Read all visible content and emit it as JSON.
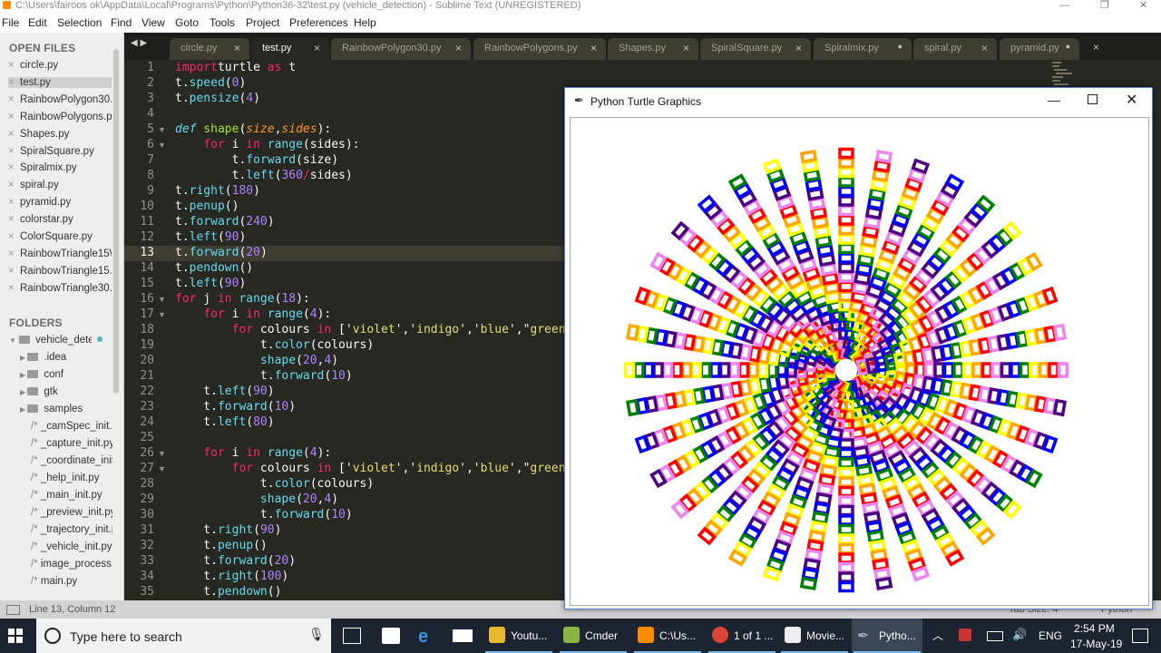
{
  "window": {
    "title": "C:\\Users\\fairoos ok\\AppData\\Local\\Programs\\Python\\Python36-32\\test.py (vehicle_detection) - Sublime Text (UNREGISTERED)"
  },
  "menu": [
    "File",
    "Edit",
    "Selection",
    "Find",
    "View",
    "Goto",
    "Tools",
    "Project",
    "Preferences",
    "Help"
  ],
  "sidebar": {
    "open_files_heading": "OPEN FILES",
    "open_files": [
      "circle.py",
      "test.py",
      "RainbowPolygon30.py",
      "RainbowPolygons.py",
      "Shapes.py",
      "SpiralSquare.py",
      "Spiralmix.py",
      "spiral.py",
      "pyramid.py",
      "colorstar.py",
      "ColorSquare.py",
      "RainbowTriangle15W",
      "RainbowTriangle15.py",
      "RainbowTriangle30.py"
    ],
    "folders_heading": "FOLDERS",
    "root_folder": "vehicle_detection",
    "folders": [
      ".idea",
      "conf",
      "gtk",
      "samples"
    ],
    "files": [
      "_camSpec_init.py",
      "_capture_init.py",
      "_coordinate_init.py",
      "_help_init.py",
      "_main_init.py",
      "_preview_init.py",
      "_trajectory_init.py",
      "_vehicle_init.py",
      "image_process.py",
      "main.py"
    ]
  },
  "tabs": [
    {
      "label": "circle.py",
      "state": "close"
    },
    {
      "label": "test.py",
      "state": "close",
      "active": true
    },
    {
      "label": "RainbowPolygon30.py",
      "state": "close"
    },
    {
      "label": "RainbowPolygons.py",
      "state": "close"
    },
    {
      "label": "Shapes.py",
      "state": "close"
    },
    {
      "label": "SpiralSquare.py",
      "state": "close"
    },
    {
      "label": "Spiralmix.py",
      "state": "dirty"
    },
    {
      "label": "spiral.py",
      "state": "close"
    },
    {
      "label": "pyramid.py",
      "state": "dirty"
    }
  ],
  "editor": {
    "current_line": 13,
    "lines": [
      [
        [
          "k",
          "import"
        ],
        [
          "",
          "turtle "
        ],
        [
          "k",
          "as"
        ],
        [
          "",
          " t"
        ]
      ],
      [
        [
          "",
          "t."
        ],
        [
          "f",
          "speed"
        ],
        [
          "",
          "("
        ],
        [
          "n",
          "0"
        ],
        [
          "",
          ")"
        ]
      ],
      [
        [
          "",
          "t."
        ],
        [
          "f",
          "pensize"
        ],
        [
          "",
          "("
        ],
        [
          "n",
          "4"
        ],
        [
          "",
          ")"
        ]
      ],
      [],
      [
        [
          "i",
          "def"
        ],
        [
          "",
          " "
        ],
        [
          "fn",
          "shape"
        ],
        [
          "",
          "("
        ],
        [
          "p",
          "size"
        ],
        [
          "",
          ","
        ],
        [
          "p",
          "sides"
        ],
        [
          "",
          "):"
        ]
      ],
      [
        [
          "",
          "    "
        ],
        [
          "k",
          "for"
        ],
        [
          "",
          " i "
        ],
        [
          "k",
          "in"
        ],
        [
          "",
          " "
        ],
        [
          "f",
          "range"
        ],
        [
          "",
          "(sides):"
        ]
      ],
      [
        [
          "",
          "        t."
        ],
        [
          "f",
          "forward"
        ],
        [
          "",
          "(size)"
        ]
      ],
      [
        [
          "",
          "        t."
        ],
        [
          "f",
          "left"
        ],
        [
          "",
          "("
        ],
        [
          "n",
          "360"
        ],
        [
          "k",
          "/"
        ],
        [
          "",
          "sides)"
        ]
      ],
      [
        [
          "",
          "t."
        ],
        [
          "f",
          "right"
        ],
        [
          "",
          "("
        ],
        [
          "n",
          "180"
        ],
        [
          "",
          ")"
        ]
      ],
      [
        [
          "",
          "t."
        ],
        [
          "f",
          "penup"
        ],
        [
          "",
          "()"
        ]
      ],
      [
        [
          "",
          "t."
        ],
        [
          "f",
          "forward"
        ],
        [
          "",
          "("
        ],
        [
          "n",
          "240"
        ],
        [
          "",
          ")"
        ]
      ],
      [
        [
          "",
          "t."
        ],
        [
          "f",
          "left"
        ],
        [
          "",
          "("
        ],
        [
          "n",
          "90"
        ],
        [
          "",
          ")"
        ]
      ],
      [
        [
          "",
          "t."
        ],
        [
          "f",
          "forward"
        ],
        [
          "",
          "("
        ],
        [
          "n",
          "20"
        ],
        [
          "",
          ")"
        ]
      ],
      [
        [
          "",
          "t."
        ],
        [
          "f",
          "pendown"
        ],
        [
          "",
          "()"
        ]
      ],
      [
        [
          "",
          "t."
        ],
        [
          "f",
          "left"
        ],
        [
          "",
          "("
        ],
        [
          "n",
          "90"
        ],
        [
          "",
          ")"
        ]
      ],
      [
        [
          "k",
          "for"
        ],
        [
          "",
          " j "
        ],
        [
          "k",
          "in"
        ],
        [
          "",
          " "
        ],
        [
          "f",
          "range"
        ],
        [
          "",
          "("
        ],
        [
          "n",
          "18"
        ],
        [
          "",
          "):"
        ]
      ],
      [
        [
          "",
          "    "
        ],
        [
          "k",
          "for"
        ],
        [
          "",
          " i "
        ],
        [
          "k",
          "in"
        ],
        [
          "",
          " "
        ],
        [
          "f",
          "range"
        ],
        [
          "",
          "("
        ],
        [
          "n",
          "4"
        ],
        [
          "",
          "):"
        ]
      ],
      [
        [
          "",
          "        "
        ],
        [
          "k",
          "for"
        ],
        [
          "",
          " colours "
        ],
        [
          "k",
          "in"
        ],
        [
          "",
          " ['"
        ],
        [
          "s",
          "violet"
        ],
        [
          "",
          "','"
        ],
        [
          "s",
          "indigo"
        ],
        [
          "",
          "','"
        ],
        [
          "s",
          "blue"
        ],
        [
          "",
          "',\""
        ],
        [
          "s",
          "green"
        ]
      ],
      [
        [
          "",
          "            t."
        ],
        [
          "f",
          "color"
        ],
        [
          "",
          "(colours)"
        ]
      ],
      [
        [
          "",
          "            "
        ],
        [
          "f",
          "shape"
        ],
        [
          "",
          "("
        ],
        [
          "n",
          "20"
        ],
        [
          "",
          ","
        ],
        [
          "n",
          "4"
        ],
        [
          "",
          ")"
        ]
      ],
      [
        [
          "",
          "            t."
        ],
        [
          "f",
          "forward"
        ],
        [
          "",
          "("
        ],
        [
          "n",
          "10"
        ],
        [
          "",
          ")"
        ]
      ],
      [
        [
          "",
          "    t."
        ],
        [
          "f",
          "left"
        ],
        [
          "",
          "("
        ],
        [
          "n",
          "90"
        ],
        [
          "",
          ")"
        ]
      ],
      [
        [
          "",
          "    t."
        ],
        [
          "f",
          "forward"
        ],
        [
          "",
          "("
        ],
        [
          "n",
          "10"
        ],
        [
          "",
          ")"
        ]
      ],
      [
        [
          "",
          "    t."
        ],
        [
          "f",
          "left"
        ],
        [
          "",
          "("
        ],
        [
          "n",
          "80"
        ],
        [
          "",
          ")"
        ]
      ],
      [],
      [
        [
          "",
          "    "
        ],
        [
          "k",
          "for"
        ],
        [
          "",
          " i "
        ],
        [
          "k",
          "in"
        ],
        [
          "",
          " "
        ],
        [
          "f",
          "range"
        ],
        [
          "",
          "("
        ],
        [
          "n",
          "4"
        ],
        [
          "",
          "):"
        ]
      ],
      [
        [
          "",
          "        "
        ],
        [
          "k",
          "for"
        ],
        [
          "",
          " colours "
        ],
        [
          "k",
          "in"
        ],
        [
          "",
          " ['"
        ],
        [
          "s",
          "violet"
        ],
        [
          "",
          "','"
        ],
        [
          "s",
          "indigo"
        ],
        [
          "",
          "','"
        ],
        [
          "s",
          "blue"
        ],
        [
          "",
          "',\""
        ],
        [
          "s",
          "green"
        ]
      ],
      [
        [
          "",
          "            t."
        ],
        [
          "f",
          "color"
        ],
        [
          "",
          "(colours)"
        ]
      ],
      [
        [
          "",
          "            "
        ],
        [
          "f",
          "shape"
        ],
        [
          "",
          "("
        ],
        [
          "n",
          "20"
        ],
        [
          "",
          ","
        ],
        [
          "n",
          "4"
        ],
        [
          "",
          ")"
        ]
      ],
      [
        [
          "",
          "            t."
        ],
        [
          "f",
          "forward"
        ],
        [
          "",
          "("
        ],
        [
          "n",
          "10"
        ],
        [
          "",
          ")"
        ]
      ],
      [
        [
          "",
          "    t."
        ],
        [
          "f",
          "right"
        ],
        [
          "",
          "("
        ],
        [
          "n",
          "90"
        ],
        [
          "",
          ")"
        ]
      ],
      [
        [
          "",
          "    t."
        ],
        [
          "f",
          "penup"
        ],
        [
          "",
          "()"
        ]
      ],
      [
        [
          "",
          "    t."
        ],
        [
          "f",
          "forward"
        ],
        [
          "",
          "("
        ],
        [
          "n",
          "20"
        ],
        [
          "",
          ")"
        ]
      ],
      [
        [
          "",
          "    t."
        ],
        [
          "f",
          "right"
        ],
        [
          "",
          "("
        ],
        [
          "n",
          "100"
        ],
        [
          "",
          ")"
        ]
      ],
      [
        [
          "",
          "    t."
        ],
        [
          "f",
          "pendown"
        ],
        [
          "",
          "()"
        ]
      ]
    ],
    "fold_lines": [
      5,
      6,
      16,
      17,
      26,
      27
    ]
  },
  "status": {
    "position": "Line 13, Column 12",
    "tab_size": "Tab Size: 4",
    "syntax": "Python"
  },
  "turtle_window": {
    "title": "Python Turtle Graphics",
    "colors": [
      "#ee82ee",
      "#4b0082",
      "#0000ff",
      "#008000",
      "#ffff00",
      "#ffa500",
      "#ff0000"
    ]
  },
  "taskbar": {
    "search_placeholder": "Type here to search",
    "items": [
      "Youtu...",
      "Cmder",
      "C:\\Us...",
      "1 of 1 ...",
      "Movie...",
      "Pytho..."
    ],
    "language": "ENG",
    "time": "2:54 PM",
    "date": "17-May-19"
  }
}
